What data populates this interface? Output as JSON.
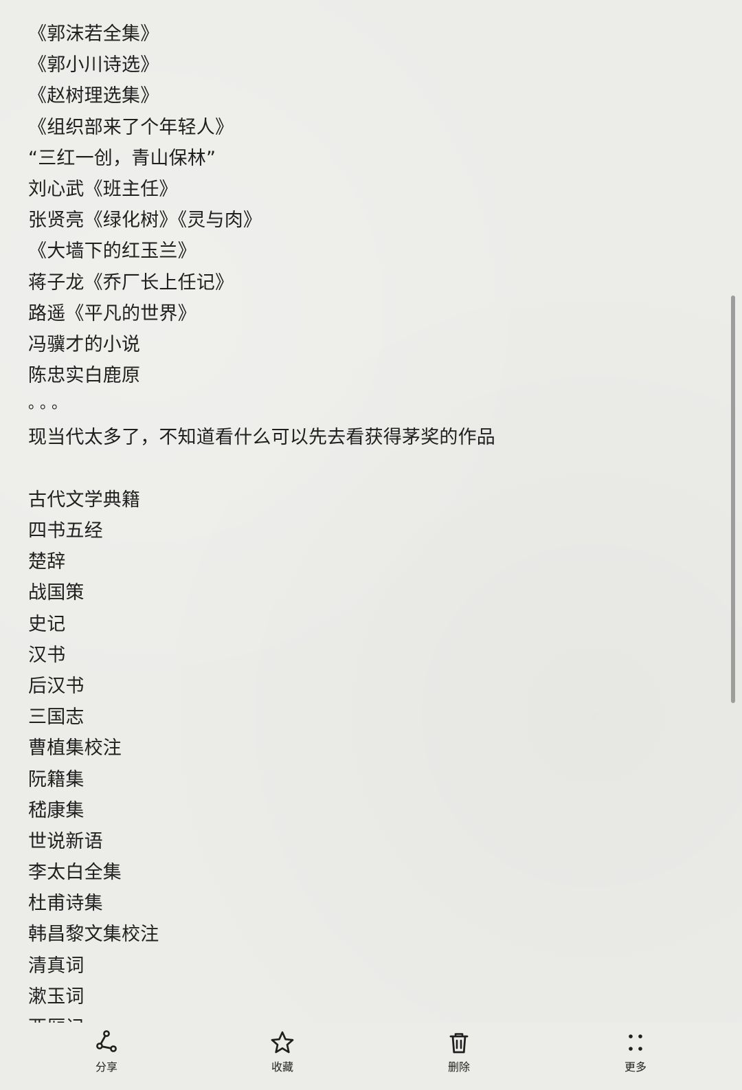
{
  "note": {
    "lines": [
      "《郭沫若全集》",
      "《郭小川诗选》",
      "《赵树理选集》",
      "《组织部来了个年轻人》",
      "“三红一创，青山保林”",
      "刘心武《班主任》",
      "张贤亮《绿化树》《灵与肉》",
      "《大墙下的红玉兰》",
      "蒋子龙《乔厂长上任记》",
      "路遥《平凡的世界》",
      "冯骥才的小说",
      "陈忠实白鹿原",
      "。。。",
      "现当代太多了，不知道看什么可以先去看获得茅奖的作品",
      "",
      "古代文学典籍",
      "四书五经",
      "楚辞",
      "战国策",
      "史记",
      "汉书",
      "后汉书",
      "三国志",
      "曹植集校注",
      "阮籍集",
      "嵇康集",
      "世说新语",
      "李太白全集",
      "杜甫诗集",
      "韩昌黎文集校注",
      "清真词",
      "漱玉词",
      "西厢记"
    ]
  },
  "toolbar": {
    "share_label": "分享",
    "favorite_label": "收藏",
    "delete_label": "删除",
    "more_label": "更多"
  },
  "icons": {
    "share": "share-icon",
    "favorite": "star-icon",
    "delete": "trash-icon",
    "more": "more-dots-icon"
  }
}
